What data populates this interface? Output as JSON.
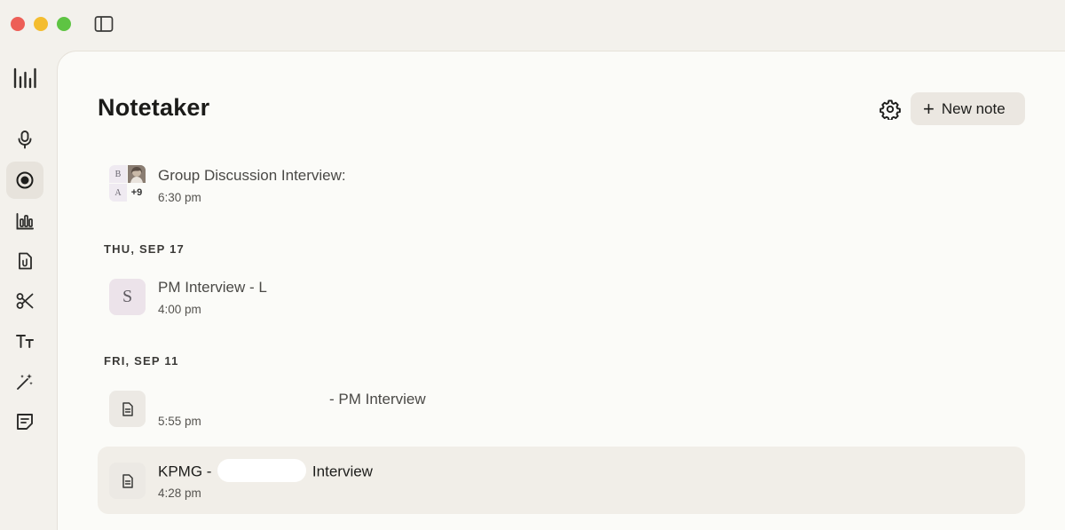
{
  "colors": {
    "window_bg": "#f3f1ec",
    "panel_bg": "#fbfbf8",
    "traffic_red": "#ed5f57",
    "traffic_yellow": "#f4bd2f",
    "traffic_green": "#5ec443",
    "button_bg": "#ebe7e1"
  },
  "rail": {
    "items": [
      {
        "name": "microphone-icon",
        "active": false
      },
      {
        "name": "record-icon",
        "active": true
      },
      {
        "name": "bar-chart-icon",
        "active": false
      },
      {
        "name": "paperclip-document-icon",
        "active": false
      },
      {
        "name": "scissors-icon",
        "active": false
      },
      {
        "name": "text-size-icon",
        "active": false
      },
      {
        "name": "magic-wand-icon",
        "active": false
      },
      {
        "name": "sticky-note-icon",
        "active": false
      }
    ]
  },
  "header": {
    "title": "Notetaker",
    "new_note_label": "New note",
    "new_note_icon": "+"
  },
  "sections": [
    {
      "date": "",
      "notes": [
        {
          "title": "Group Discussion Interview:",
          "time": "6:30 pm",
          "icon": "participants",
          "participants": {
            "initial_1": "B",
            "initial_2": "A",
            "more": "+9"
          }
        }
      ]
    },
    {
      "date": "THU, SEP 17",
      "notes": [
        {
          "title": "PM Interview - L",
          "time": "4:00 pm",
          "icon": "letter",
          "letter": "S"
        }
      ]
    },
    {
      "date": "FRI, SEP 11",
      "notes": [
        {
          "title_suffix": "- PM Interview",
          "time": "5:55 pm",
          "icon": "document-icon"
        },
        {
          "title_prefix": "KPMG -",
          "title_suffix": "Interview",
          "time": "4:28 pm",
          "icon": "document-icon"
        }
      ]
    }
  ]
}
